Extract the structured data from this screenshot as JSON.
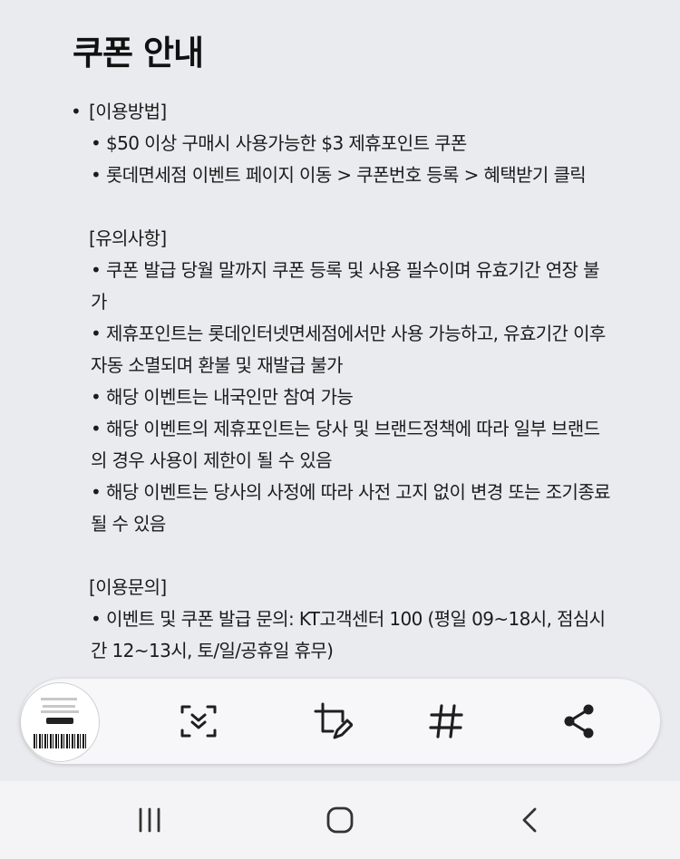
{
  "page": {
    "title": "쿠폰 안내"
  },
  "guide": {
    "bullet": "•",
    "usage": {
      "header": "[이용방법]",
      "items": [
        "• $50 이상 구매시 사용가능한 $3 제휴포인트 쿠폰",
        "• 롯데면세점 이벤트 페이지 이동 > 쿠폰번호 등록 > 혜택받기 클릭"
      ]
    },
    "notes": {
      "header": "[유의사항]",
      "items": [
        "• 쿠폰 발급 당월 말까지 쿠폰 등록 및 사용 필수이며 유효기간 연장 불가",
        "• 제휴포인트는 롯데인터넷면세점에서만 사용 가능하고, 유효기간 이후 자동 소멸되며 환불 및 재발급 불가",
        "• 해당 이벤트는 내국인만 참여 가능",
        "• 해당 이벤트의 제휴포인트는 당사 및 브랜드정책에 따라 일부 브랜드의 경우 사용이 제한이 될 수 있음",
        "• 해당 이벤트는 당사의 사정에 따라 사전 고지 없이 변경 또는 조기종료 될 수 있음"
      ]
    },
    "inquiry": {
      "header": "[이용문의]",
      "items": [
        "• 이벤트 및 쿠폰 발급 문의: KT고객센터 100 (평일 09~18시, 점심시간 12~13시, 토/일/공휴일 휴무)"
      ]
    }
  },
  "toolbar": {
    "icons": [
      "screenshot-thumbnail",
      "scroll-capture-icon",
      "crop-edit-icon",
      "hashtag-icon",
      "share-icon"
    ],
    "hashtag_glyph": "#"
  },
  "navbar": {
    "icons": [
      "recents-icon",
      "home-icon",
      "back-icon"
    ]
  },
  "colors": {
    "background": "#eaebef",
    "toolbar": "#f7f7f9",
    "navbar": "#f4f4f6",
    "icon": "#1f1f1f"
  }
}
